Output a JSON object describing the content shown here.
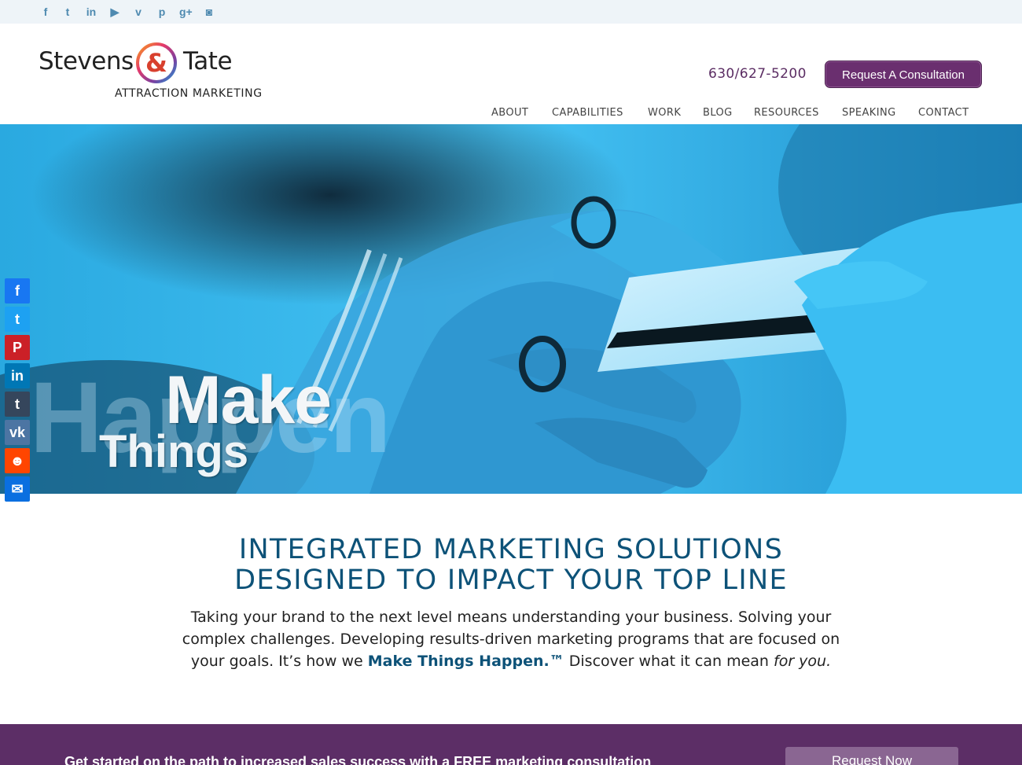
{
  "social_top": [
    {
      "icon": "facebook-icon",
      "glyph": "f"
    },
    {
      "icon": "twitter-icon",
      "glyph": "t"
    },
    {
      "icon": "linkedin-icon",
      "glyph": "in"
    },
    {
      "icon": "youtube-icon",
      "glyph": "▶"
    },
    {
      "icon": "vimeo-icon",
      "glyph": "v"
    },
    {
      "icon": "pinterest-icon",
      "glyph": "p"
    },
    {
      "icon": "google-plus-icon",
      "glyph": "g+"
    },
    {
      "icon": "instagram-icon",
      "glyph": "◙"
    }
  ],
  "logo": {
    "left": "Stevens",
    "amp": "&",
    "right": "Tate",
    "tagline": "ATTRACTION MARKETING"
  },
  "header": {
    "phone": "630/627-5200",
    "cta": "Request A Consultation"
  },
  "nav": [
    "ABOUT",
    "CAPABILITIES",
    "WORK",
    "BLOG",
    "RESOURCES",
    "SPEAKING",
    "CONTACT"
  ],
  "hero": {
    "line1": "Make",
    "line2": "Things",
    "line3": "Happen",
    "tm": "™"
  },
  "share": [
    {
      "icon": "facebook-share-icon",
      "glyph": "f",
      "color": "#1877f2"
    },
    {
      "icon": "twitter-share-icon",
      "glyph": "t",
      "color": "#1da1f2"
    },
    {
      "icon": "pinterest-share-icon",
      "glyph": "P",
      "color": "#cb2027"
    },
    {
      "icon": "linkedin-share-icon",
      "glyph": "in",
      "color": "#0077b5"
    },
    {
      "icon": "tumblr-share-icon",
      "glyph": "t",
      "color": "#35465c"
    },
    {
      "icon": "vk-share-icon",
      "glyph": "vk",
      "color": "#4c75a3"
    },
    {
      "icon": "reddit-share-icon",
      "glyph": "☻",
      "color": "#ff4500"
    },
    {
      "icon": "email-share-icon",
      "glyph": "✉",
      "color": "#0a6fe0"
    }
  ],
  "content": {
    "headline1": "INTEGRATED MARKETING SOLUTIONS",
    "headline2": "DESIGNED TO IMPACT YOUR TOP LINE",
    "para_part1": "Taking your brand to the next level means understanding your business. Solving your complex challenges. Developing results-driven marketing programs that are focused on your goals. It’s how we ",
    "para_highlight": "Make Things Happen.™",
    "para_part2": " Discover what it can mean ",
    "para_italic": "for you.",
    "para_end": ""
  },
  "band": {
    "text": "Get started on the path to increased sales success with a FREE marketing consultation",
    "button": "Request Now"
  },
  "colors": {
    "brand_purple": "#5c2e66",
    "headline_blue": "#0d5278",
    "hero_cyan": "#2eb8ee"
  }
}
